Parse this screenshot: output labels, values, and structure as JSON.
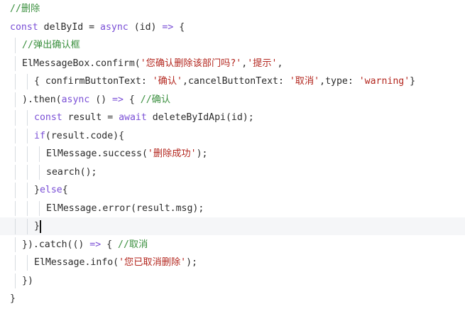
{
  "editor": {
    "lines": [
      {
        "indent": 0,
        "tokens": [
          {
            "t": "com",
            "v": "//删除"
          }
        ]
      },
      {
        "indent": 0,
        "tokens": [
          {
            "t": "kw",
            "v": "const"
          },
          {
            "t": "fn",
            "v": " delById = "
          },
          {
            "t": "kw",
            "v": "async"
          },
          {
            "t": "fn",
            "v": " (id) "
          },
          {
            "t": "kw",
            "v": "=>"
          },
          {
            "t": "fn",
            "v": " {"
          }
        ]
      },
      {
        "indent": 1,
        "tokens": [
          {
            "t": "com",
            "v": "//弹出确认框"
          }
        ]
      },
      {
        "indent": 1,
        "tokens": [
          {
            "t": "fn",
            "v": "ElMessageBox.confirm("
          },
          {
            "t": "str",
            "v": "'您确认删除该部门吗?'"
          },
          {
            "t": "fn",
            "v": ","
          },
          {
            "t": "str",
            "v": "'提示'"
          },
          {
            "t": "fn",
            "v": ","
          }
        ]
      },
      {
        "indent": 2,
        "tokens": [
          {
            "t": "fn",
            "v": "{ confirmButtonText: "
          },
          {
            "t": "str",
            "v": "'确认'"
          },
          {
            "t": "fn",
            "v": ",cancelButtonText: "
          },
          {
            "t": "str",
            "v": "'取消'"
          },
          {
            "t": "fn",
            "v": ",type: "
          },
          {
            "t": "str",
            "v": "'warning'"
          },
          {
            "t": "fn",
            "v": "}"
          }
        ]
      },
      {
        "indent": 1,
        "tokens": [
          {
            "t": "fn",
            "v": ").then("
          },
          {
            "t": "kw",
            "v": "async"
          },
          {
            "t": "fn",
            "v": " () "
          },
          {
            "t": "kw",
            "v": "=>"
          },
          {
            "t": "fn",
            "v": " { "
          },
          {
            "t": "com",
            "v": "//确认"
          }
        ]
      },
      {
        "indent": 2,
        "tokens": [
          {
            "t": "kw",
            "v": "const"
          },
          {
            "t": "fn",
            "v": " result = "
          },
          {
            "t": "kw",
            "v": "await"
          },
          {
            "t": "fn",
            "v": " deleteByIdApi(id);"
          }
        ]
      },
      {
        "indent": 2,
        "tokens": [
          {
            "t": "kw",
            "v": "if"
          },
          {
            "t": "fn",
            "v": "(result.code){"
          }
        ]
      },
      {
        "indent": 3,
        "tokens": [
          {
            "t": "fn",
            "v": "ElMessage.success("
          },
          {
            "t": "str",
            "v": "'删除成功'"
          },
          {
            "t": "fn",
            "v": ");"
          }
        ]
      },
      {
        "indent": 3,
        "tokens": [
          {
            "t": "fn",
            "v": "search();"
          }
        ]
      },
      {
        "indent": 2,
        "tokens": [
          {
            "t": "fn",
            "v": "}"
          },
          {
            "t": "kw",
            "v": "else"
          },
          {
            "t": "fn",
            "v": "{"
          }
        ]
      },
      {
        "indent": 3,
        "tokens": [
          {
            "t": "fn",
            "v": "ElMessage.error(result.msg);"
          }
        ]
      },
      {
        "indent": 2,
        "tokens": [
          {
            "t": "fn",
            "v": "}"
          }
        ],
        "current": true
      },
      {
        "indent": 1,
        "tokens": [
          {
            "t": "fn",
            "v": "}).catch(() "
          },
          {
            "t": "kw",
            "v": "=>"
          },
          {
            "t": "fn",
            "v": " { "
          },
          {
            "t": "com",
            "v": "//取消"
          }
        ]
      },
      {
        "indent": 2,
        "tokens": [
          {
            "t": "fn",
            "v": "ElMessage.info("
          },
          {
            "t": "str",
            "v": "'您已取消删除'"
          },
          {
            "t": "fn",
            "v": ");"
          }
        ]
      },
      {
        "indent": 1,
        "tokens": [
          {
            "t": "fn",
            "v": "})"
          }
        ]
      },
      {
        "indent": 0,
        "tokens": [
          {
            "t": "fn",
            "v": "}"
          }
        ]
      }
    ]
  }
}
